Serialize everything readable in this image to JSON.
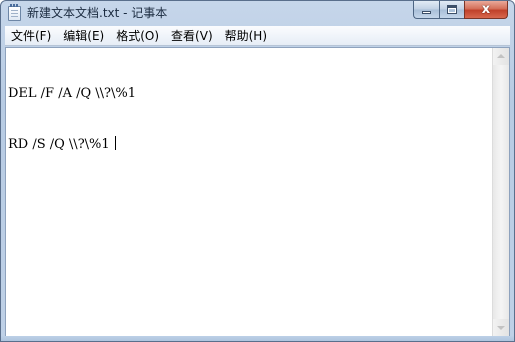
{
  "window": {
    "title": "新建文本文档.txt - 记事本"
  },
  "caption_buttons": {
    "minimize": "minimize",
    "maximize": "maximize",
    "close": "x"
  },
  "menu": {
    "items": [
      {
        "label": "文件(F)"
      },
      {
        "label": "编辑(E)"
      },
      {
        "label": "格式(O)"
      },
      {
        "label": "查看(V)"
      },
      {
        "label": "帮助(H)"
      }
    ]
  },
  "editor": {
    "lines": [
      "DEL /F /A /Q \\\\?\\%1",
      "RD /S /Q \\\\?\\%1 "
    ]
  },
  "icons": {
    "app": "notepad-icon",
    "scroll_up": "scroll-up-arrow-icon",
    "scroll_down": "scroll-down-arrow-icon"
  }
}
